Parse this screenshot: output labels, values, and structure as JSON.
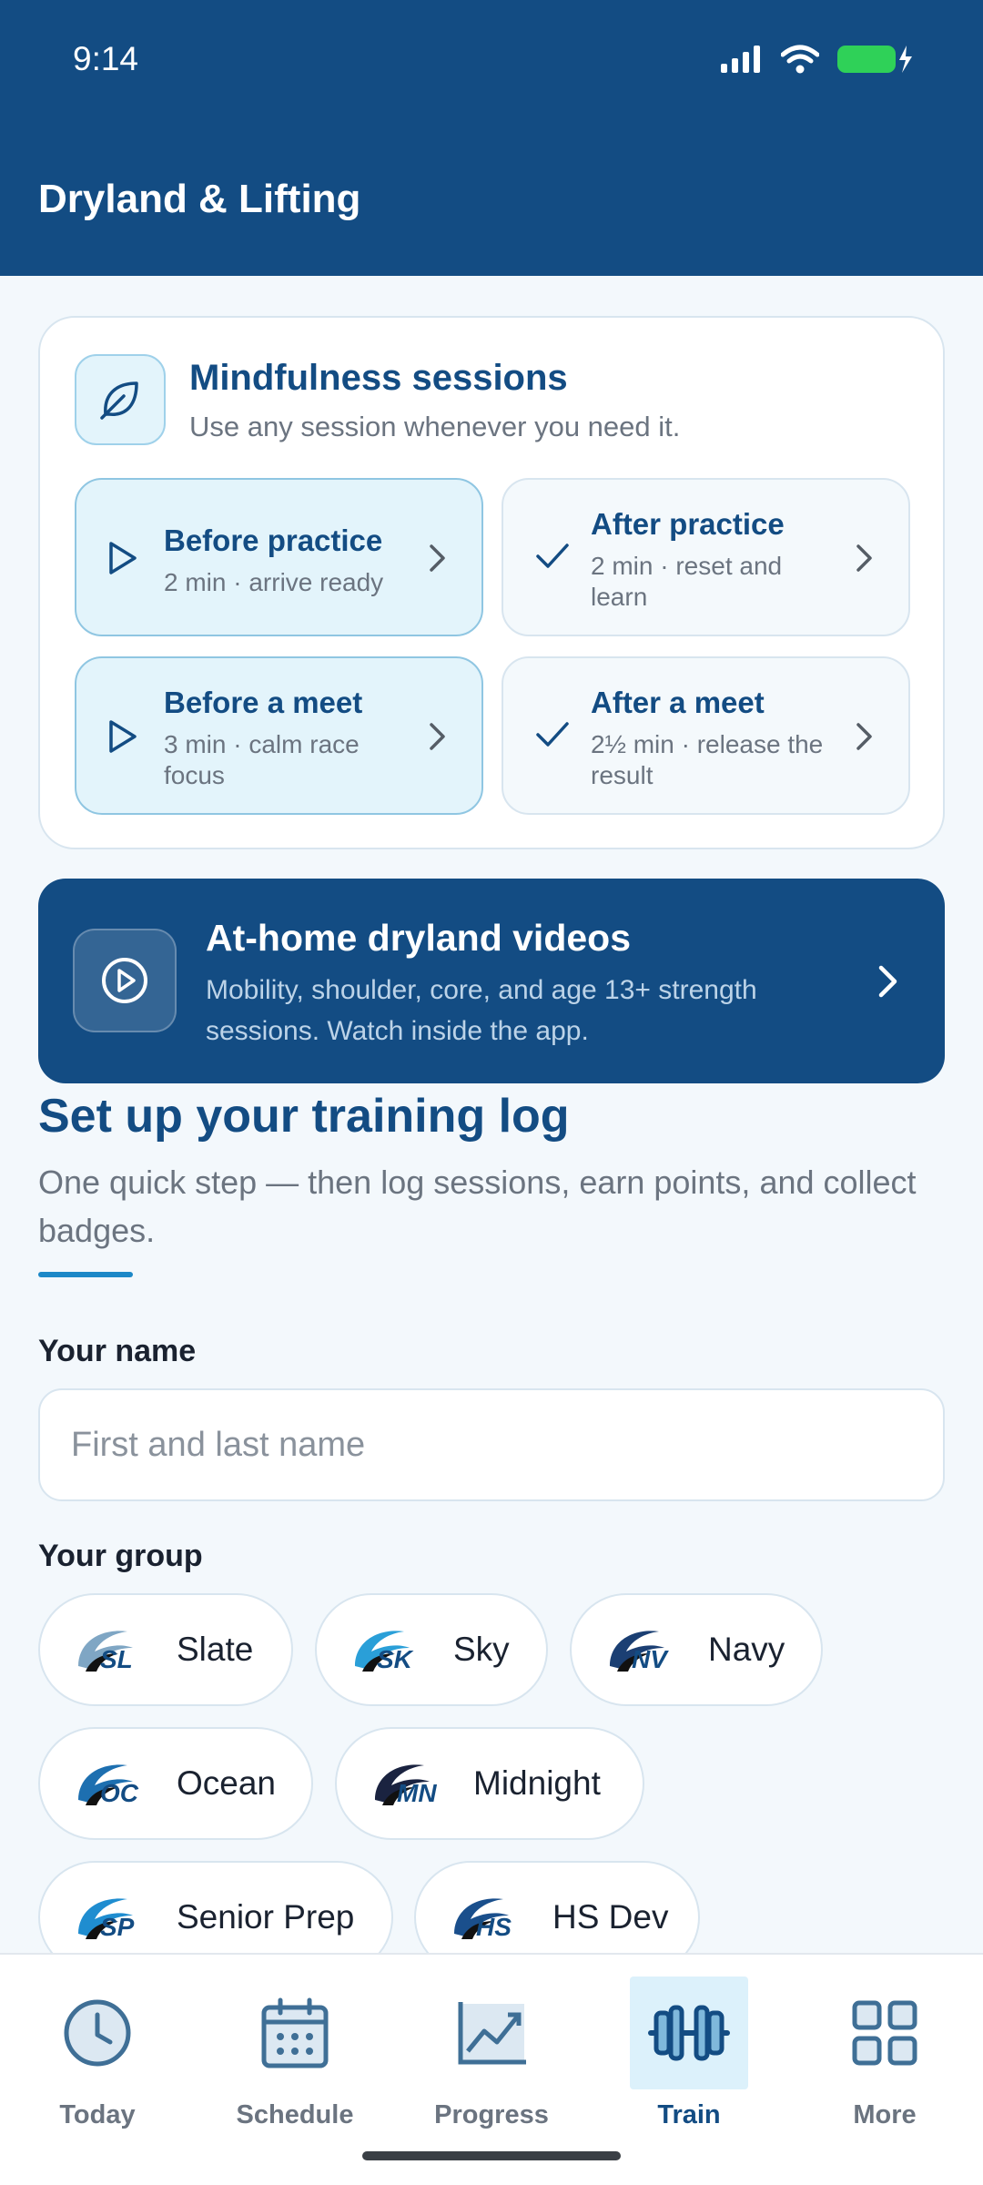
{
  "status": {
    "time": "9:14"
  },
  "header": {
    "title": "Dryland & Lifting"
  },
  "mindfulness": {
    "title": "Mindfulness sessions",
    "subtitle": "Use any session whenever you need it.",
    "sessions": [
      {
        "title": "Before practice",
        "sub": "2 min · arrive ready",
        "icon": "play-icon",
        "state": "active"
      },
      {
        "title": "After practice",
        "sub": "2 min · reset and learn",
        "icon": "check-icon",
        "state": "done"
      },
      {
        "title": "Before a meet",
        "sub": "3 min · calm race focus",
        "icon": "play-icon",
        "state": "active"
      },
      {
        "title": "After a meet",
        "sub": "2½ min · release the result",
        "icon": "check-icon",
        "state": "done"
      }
    ]
  },
  "videos": {
    "title": "At-home dryland videos",
    "subtitle": "Mobility, shoulder, core, and age 13+ strength sessions. Watch inside the app."
  },
  "setup": {
    "title": "Set up your training log",
    "subtitle": "One quick step — then log sessions, earn points, and collect badges.",
    "name_label": "Your name",
    "name_placeholder": "First and last name",
    "name_value": "",
    "group_label": "Your group",
    "groups": [
      {
        "label": "Slate",
        "abbr": "SL",
        "color": "#7fa6c4"
      },
      {
        "label": "Sky",
        "abbr": "SK",
        "color": "#2a9fd8"
      },
      {
        "label": "Navy",
        "abbr": "NV",
        "color": "#1b3f73"
      },
      {
        "label": "Ocean",
        "abbr": "OC",
        "color": "#1d6fb0"
      },
      {
        "label": "Midnight",
        "abbr": "MN",
        "color": "#1a2340"
      },
      {
        "label": "Senior Prep",
        "abbr": "SP",
        "color": "#1f8dd0"
      },
      {
        "label": "HS Dev",
        "abbr": "HS",
        "color": "#1a4f8c"
      }
    ]
  },
  "tabs": [
    {
      "label": "Today",
      "icon": "clock-icon",
      "active": false
    },
    {
      "label": "Schedule",
      "icon": "calendar-icon",
      "active": false
    },
    {
      "label": "Progress",
      "icon": "chart-icon",
      "active": false
    },
    {
      "label": "Train",
      "icon": "dumbbell-icon",
      "active": true
    },
    {
      "label": "More",
      "icon": "grid-icon",
      "active": false
    }
  ],
  "colors": {
    "primary": "#134c83",
    "accent": "#1c88c7",
    "background": "#f3f8fc"
  }
}
